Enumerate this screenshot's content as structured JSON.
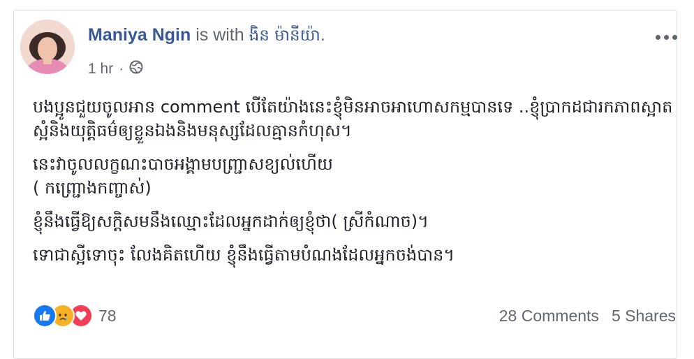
{
  "post": {
    "author": "Maniya Ngin",
    "with_text": "is with",
    "tagged": "ងិន ម៉ានីយ៉ា",
    "tagged_suffix": ".",
    "time": "1 hr",
    "separator": "·",
    "privacy_icon": "globe-icon",
    "more_icon": "more-options-icon",
    "paragraphs": [
      "បងប្អូនជួយចូលអាន comment បើតែយ៉ាងនេះខ្ញុំមិនអាចអាហោសកម្មបានទេ ..ខ្ញុំប្រាកដជារកភាពស្អាតស្អំនិងយុត្តិធម៌ឲ្យខ្លួនឯងនិងមនុស្សដែលគ្មានកំហុស។",
      "នេះវាចូលលក្ខណះបាចអង្គាមបញ្ជ្រាសខ្យល់ហើយ",
      "( កញ្ជ្រោងកញ្ចាស់)",
      "ខ្ញុំនឹងធ្វើឱ្យសក្តិសមនឹងឈ្មោះដែលអ្នកដាក់ឲ្យខ្ញុំថា( ស្រីកំណាច)។",
      "ទោជាស្អីទោចុះ លែងគិតហើយ ខ្ញុំនឹងធ្វើតាមបំណងដែលអ្នកចង់បាន។"
    ]
  },
  "stats": {
    "reactions": [
      "like",
      "sad",
      "love"
    ],
    "reaction_count": "78",
    "comments": "28 Comments",
    "shares": "5 Shares"
  },
  "colors": {
    "link": "#385898",
    "text": "#1d2129",
    "muted": "#606770",
    "like": "#1877f2",
    "sad": "#f7b125",
    "love": "#f33e58"
  }
}
